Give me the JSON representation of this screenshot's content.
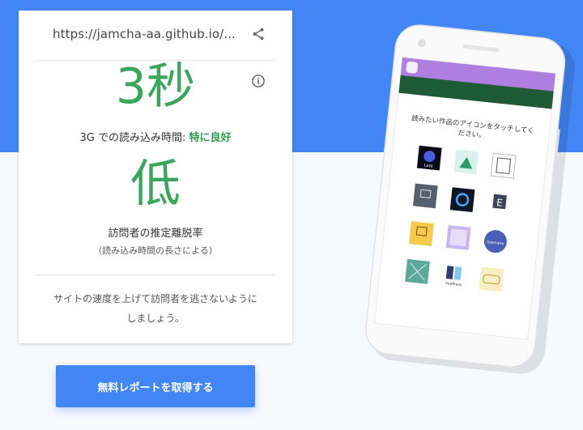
{
  "report": {
    "url": "https://jamcha-aa.github.io/...",
    "load_time": "3秒",
    "speed_prefix": "3G での読み込み時間: ",
    "speed_rating": "特に良好",
    "bounce_value": "低",
    "bounce_label": "訪問者の推定離脱率",
    "bounce_note": "（読み込み時間の長さによる）",
    "advice_line1": "サイトの速度を上げて訪問者を逃さないように",
    "advice_line2": "しましょう。",
    "cta_label": "無料レポートを取得する"
  },
  "phone": {
    "instruction_line1": "読みたい作品のアイコンをタッチしてく",
    "instruction_line2": "ださい。",
    "apps": [
      {
        "label": "Lore"
      },
      {
        "label": ""
      },
      {
        "label": ""
      },
      {
        "label": ""
      },
      {
        "label": ""
      },
      {
        "label": "E"
      },
      {
        "label": ""
      },
      {
        "label": ""
      },
      {
        "label": "fowmana"
      },
      {
        "label": ""
      },
      {
        "label": "VuePress"
      },
      {
        "label": ""
      }
    ]
  },
  "colors": {
    "accent_blue": "#4285f4",
    "good_green": "#3ba55c",
    "phone_header_purple": "#b07de0",
    "phone_header_green": "#1f5a36"
  },
  "icons": [
    "share-icon",
    "info-icon"
  ]
}
